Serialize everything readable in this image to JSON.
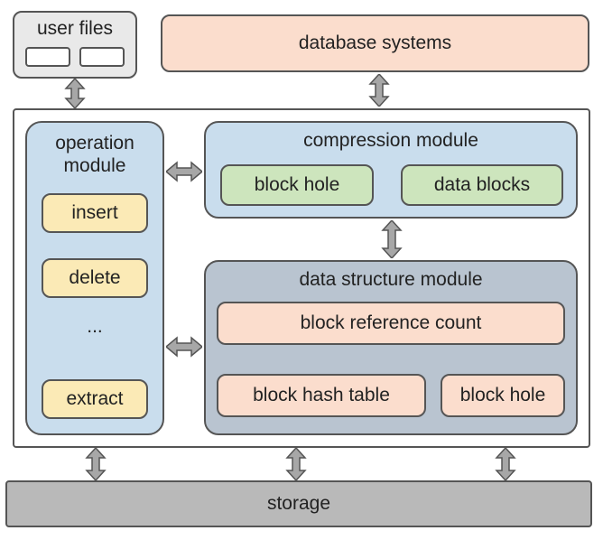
{
  "top": {
    "user_files": "user files",
    "database_systems": "database systems"
  },
  "operation_module": {
    "title": "operation\nmodule",
    "ops": [
      "insert",
      "delete",
      "...",
      "extract"
    ]
  },
  "compression_module": {
    "title": "compression module",
    "items": [
      "block hole",
      "data blocks"
    ]
  },
  "data_structure_module": {
    "title": "data structure module",
    "rows": {
      "row1": [
        "block reference count"
      ],
      "row2": [
        "block hash table",
        "block hole"
      ]
    }
  },
  "storage": "storage"
}
